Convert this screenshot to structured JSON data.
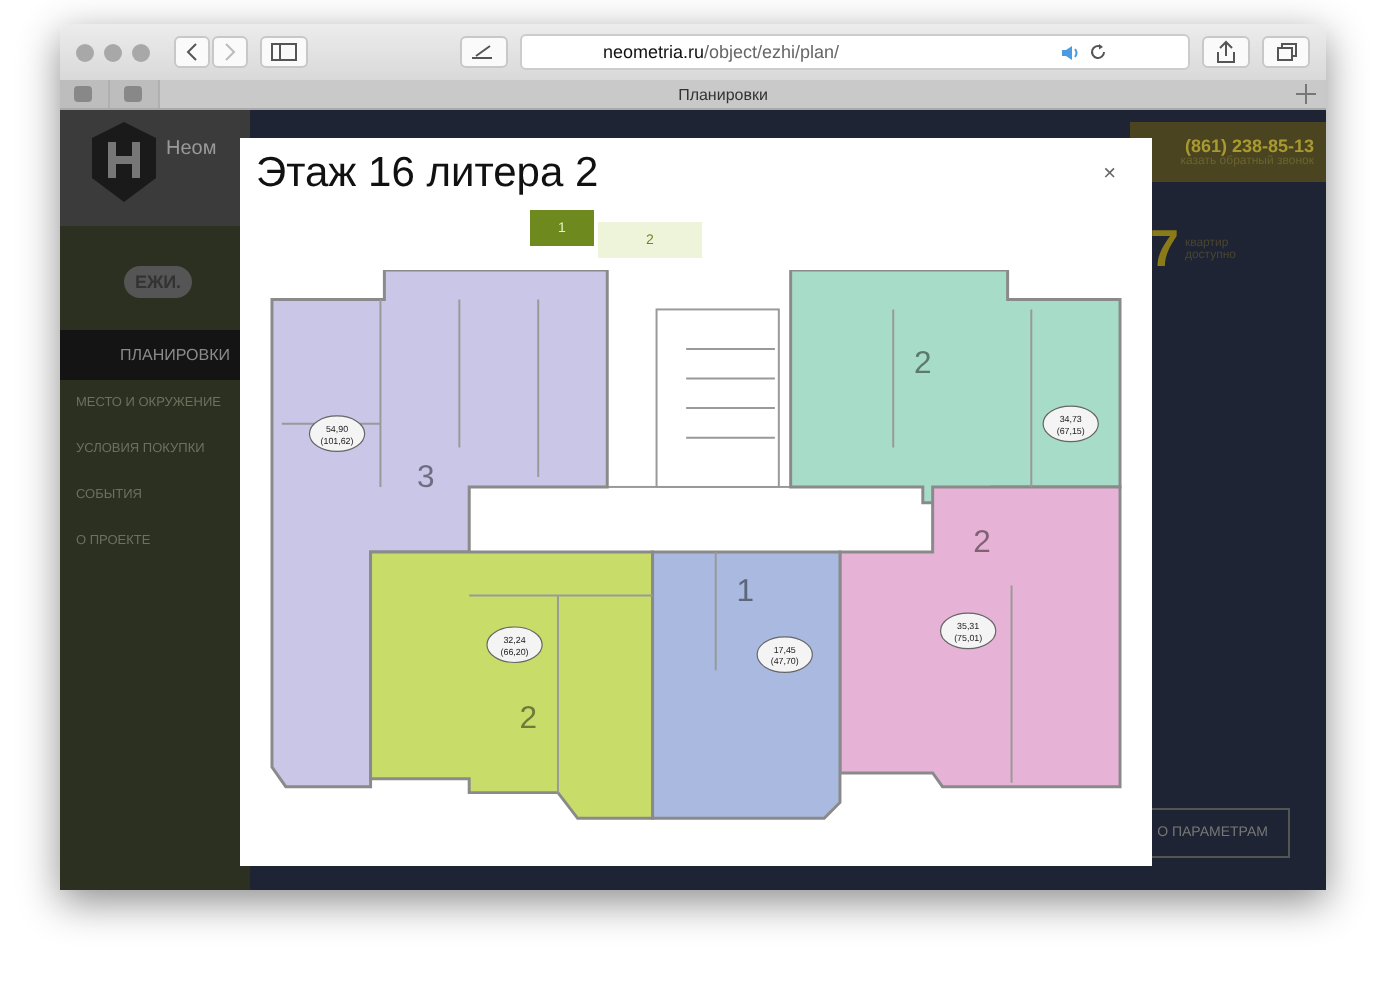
{
  "browser": {
    "url_host": "neometria.ru",
    "url_path": "/object/ezhi/plan/",
    "tab_title": "Планировки"
  },
  "site": {
    "logo_text": "Неом",
    "project_logo": "ЕЖИ.",
    "phone": "(861) 238-85-13",
    "callback": "казать обратный звонок",
    "counter": "7",
    "counter_label_1": "квартир",
    "counter_label_2": "доступно",
    "params_button": "О ПАРАМЕТРАМ"
  },
  "nav": [
    {
      "label": "ПЛАНИРОВКИ",
      "selected": true
    },
    {
      "label": "МЕСТО И ОКРУЖЕНИЕ",
      "selected": false
    },
    {
      "label": "УСЛОВИЯ ПОКУПКИ",
      "selected": false
    },
    {
      "label": "СОБЫТИЯ",
      "selected": false
    },
    {
      "label": "О ПРОЕКТЕ",
      "selected": false
    }
  ],
  "modal": {
    "title": "Этаж 16 литера 2",
    "close": "×",
    "sections": [
      {
        "label": "1",
        "selected": true
      },
      {
        "label": "2",
        "selected": false
      }
    ]
  },
  "apartments": [
    {
      "rooms": "3",
      "area": "54,90",
      "total": "(101,62)",
      "color": "#c9c6e8"
    },
    {
      "rooms": "2",
      "area": "34,73",
      "total": "(67,15)",
      "color": "#a6dcc8"
    },
    {
      "rooms": "2",
      "area": "35,31",
      "total": "(75,01)",
      "color": "#e6b3d6"
    },
    {
      "rooms": "2",
      "area": "32,24",
      "total": "(66,20)",
      "color": "#c8dc6a"
    },
    {
      "rooms": "1",
      "area": "17,45",
      "total": "(47,70)",
      "color": "#a9b9e0"
    }
  ]
}
